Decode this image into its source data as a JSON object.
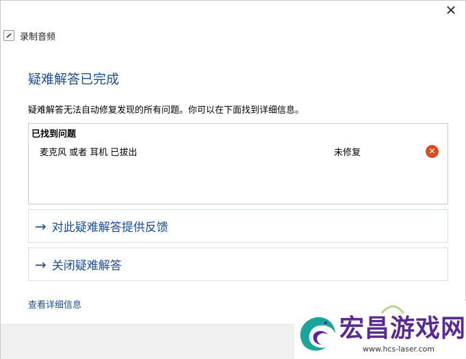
{
  "window": {
    "title": "录制音频",
    "close_glyph": "✕"
  },
  "main": {
    "heading": "疑难解答已完成",
    "description": "疑难解答无法自动修复发现的所有问题。你可以在下面找到详细信息。",
    "problems": {
      "header": "已找到问题",
      "items": [
        {
          "name": "麦克风 或者 耳机 已拔出",
          "status": "未修复",
          "status_icon": "error-icon"
        }
      ]
    },
    "links": [
      {
        "label": "对此疑难解答提供反馈",
        "arrow": "→"
      },
      {
        "label": "关闭疑难解答",
        "arrow": "→"
      }
    ],
    "details_link": "查看详细信息"
  },
  "watermark": {
    "text": "宏昌游戏网",
    "url": "www.hcs-laser.com"
  },
  "colors": {
    "accent": "#1a4d8f",
    "error": "#d94d1e",
    "watermark": "#5a2a93"
  }
}
